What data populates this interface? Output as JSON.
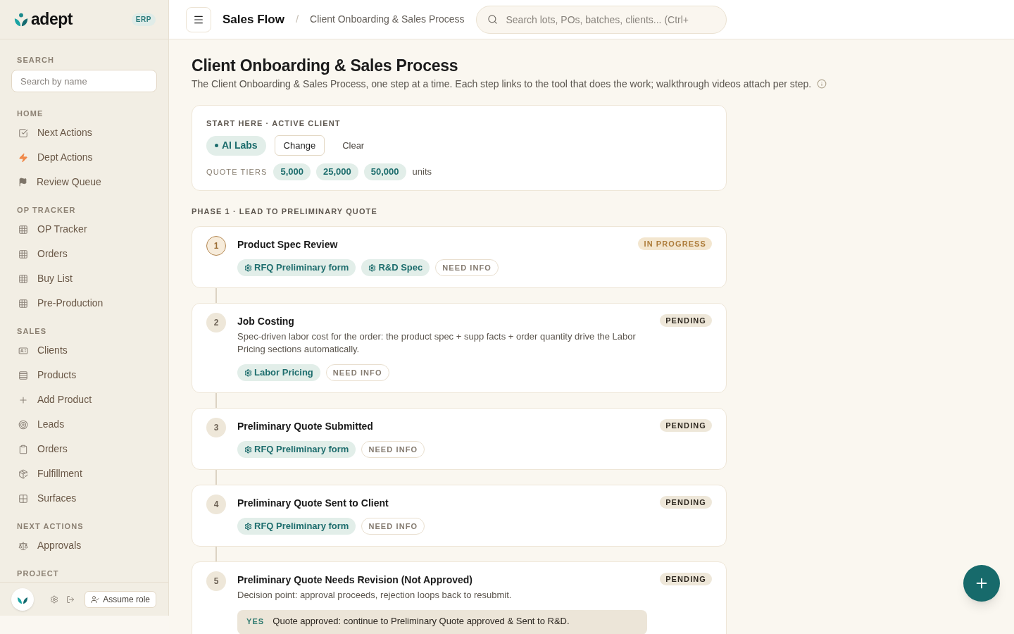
{
  "sidebar": {
    "brand": {
      "name": "adept",
      "badge": "ERP"
    },
    "search": {
      "label": "SEARCH",
      "placeholder": "Search by name"
    },
    "sections": [
      {
        "title": "HOME",
        "items": [
          {
            "label": "Next Actions",
            "selected": false
          },
          {
            "label": "Dept Actions",
            "selected": false
          },
          {
            "label": "Review Queue",
            "selected": false
          }
        ]
      },
      {
        "title": "OP TRACKER",
        "items": [
          {
            "label": "OP Tracker",
            "selected": false
          },
          {
            "label": "Orders",
            "selected": false
          },
          {
            "label": "Buy List",
            "selected": false
          },
          {
            "label": "Pre-Production",
            "selected": false
          }
        ]
      },
      {
        "title": "SALES",
        "items": [
          {
            "label": "Clients",
            "selected": false
          },
          {
            "label": "Products",
            "selected": false
          },
          {
            "label": "Add Product",
            "selected": false
          },
          {
            "label": "Leads",
            "selected": false
          },
          {
            "label": "Orders",
            "selected": false
          },
          {
            "label": "Fulfillment",
            "selected": false
          },
          {
            "label": "Surfaces",
            "selected": false
          }
        ]
      },
      {
        "title": "NEXT ACTIONS",
        "items": [
          {
            "label": "Approvals",
            "selected": false
          }
        ]
      },
      {
        "title": "PROJECT"
      }
    ],
    "footer": {
      "button": "Assume role"
    }
  },
  "topbar": {
    "title": "Sales Flow",
    "separator": "/",
    "breadcrumb": "Client Onboarding & Sales Process",
    "search": {
      "placeholder": "Search lots, POs, batches, clients... (Ctrl+"
    }
  },
  "page": {
    "title": "Client Onboarding & Sales Process",
    "subtitle": "The Client Onboarding & Sales Process, one step at a time. Each step links to the tool that does the work; walkthrough videos attach per step."
  },
  "active_client": {
    "heading": "START HERE · ACTIVE CLIENT",
    "client": "AI Labs",
    "change": "Change",
    "clear": "Clear",
    "tiers_label": "QUOTE TIERS",
    "tiers": [
      "5,000",
      "25,000",
      "50,000"
    ],
    "unit": "units"
  },
  "phase": {
    "title": "PHASE 1 · LEAD TO PRELIMINARY QUOTE",
    "steps": [
      {
        "number": "1",
        "title": "Product Spec Review",
        "status": "IN PROGRESS",
        "current": true,
        "tools": [
          "RFQ Preliminary form",
          "R&D Spec"
        ],
        "action": "NEED INFO"
      },
      {
        "number": "2",
        "title": "Job Costing",
        "status": "PENDING",
        "current": false,
        "description": "Spec-driven labor cost for the order: the product spec + supp facts + order quantity drive the Labor Pricing sections automatically.",
        "tools": [
          "Labor Pricing"
        ],
        "action": "NEED INFO"
      },
      {
        "number": "3",
        "title": "Preliminary Quote Submitted",
        "status": "PENDING",
        "current": false,
        "tools": [
          "RFQ Preliminary form"
        ],
        "action": "NEED INFO"
      },
      {
        "number": "4",
        "title": "Preliminary Quote Sent to Client",
        "status": "PENDING",
        "current": false,
        "tools": [
          "RFQ Preliminary form"
        ],
        "action": "NEED INFO"
      },
      {
        "number": "5",
        "title": "Preliminary Quote Needs Revision (Not Approved)",
        "status": "PENDING",
        "current": false,
        "description": "Decision point: approval proceeds, rejection loops back to resubmit.",
        "branches": [
          {
            "label": "YES",
            "text": "Quote approved: continue to Preliminary Quote approved & Sent to R&D."
          }
        ]
      }
    ]
  }
}
